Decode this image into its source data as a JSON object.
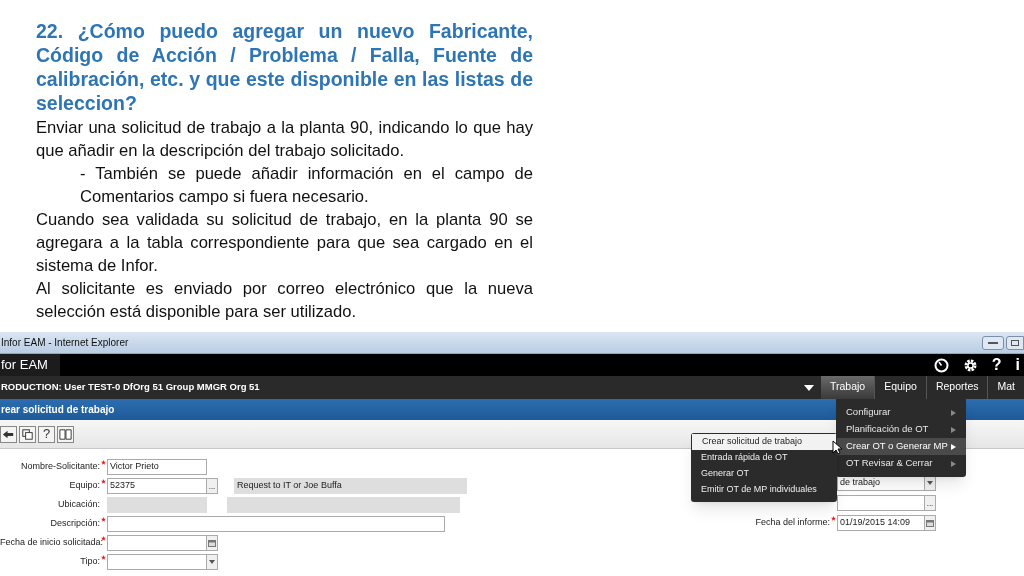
{
  "slide": {
    "title": "22. ¿Cómo puedo agregar un nuevo Fabricante, Código de Acción / Problema / Falla, Fuente de calibración, etc. y que este disponible en las listas de seleccion?",
    "paragraphs": [
      {
        "kind": "body",
        "text": "Enviar una solicitud de trabajo a la planta 90,  indicando  lo que hay que añadir en la descripción del trabajo solicitado."
      },
      {
        "kind": "indented",
        "text": "- También se puede añadir información en el campo de Comentarios campo si fuera necesario."
      },
      {
        "kind": "body",
        "text": "Cuando sea validada su solicitud de trabajo, en la planta 90 se agregara a la tabla correspondiente para que sea cargado en el sistema de Infor."
      },
      {
        "kind": "body",
        "text": "Al solicitante es enviado por correo electrónico que la nueva selección está disponible para ser utilizado."
      }
    ]
  },
  "window": {
    "title": "Infor EAM - Internet Explorer"
  },
  "app": {
    "name": "for EAM",
    "context": "RODUCTION: User TEST-0 DfOrg 51 Group MMGR Org 51",
    "header_icons": [
      {
        "kind": "dashboard"
      },
      {
        "kind": "settings"
      },
      {
        "kind": "help",
        "text": "?"
      },
      {
        "kind": "info",
        "text": "i"
      }
    ],
    "nav": [
      {
        "label": "Trabajo",
        "selected": true
      },
      {
        "label": "Equipo",
        "selected": false
      },
      {
        "label": "Reportes",
        "selected": false
      },
      {
        "label": "Mat",
        "selected": false
      }
    ]
  },
  "page_title": "rear solicitud de trabajo",
  "toolbar": [
    {
      "kind": "back"
    },
    {
      "kind": "copy"
    },
    {
      "kind": "help",
      "text": "?"
    },
    {
      "kind": "book"
    }
  ],
  "form_left": [
    {
      "label": "Nombre-Solicitante:",
      "required": true,
      "kind": "text",
      "value": "Victor Prieto"
    },
    {
      "label": "Equipo:",
      "required": true,
      "kind": "lookup",
      "value": "52375",
      "button": "...",
      "description": "Request to IT or Joe Buffa"
    },
    {
      "label": "Ubicación:",
      "required": false,
      "kind": "readonly"
    },
    {
      "label": "Descripción:",
      "required": true,
      "kind": "wide"
    },
    {
      "label": "Fecha de inicio solicitada:",
      "required": true,
      "kind": "date"
    },
    {
      "label": "Tipo:",
      "required": true,
      "kind": "select"
    }
  ],
  "form_right": [
    {
      "kind": "select",
      "value": "de trabajo"
    },
    {
      "kind": "lookup",
      "button": "..."
    },
    {
      "label": "Fecha del informe:",
      "required": true,
      "kind": "date",
      "value": "01/19/2015 14:09"
    }
  ],
  "menu": [
    {
      "label": "Configurar",
      "selected": false
    },
    {
      "label": "Planificación de OT",
      "selected": false
    },
    {
      "label": "Crear OT o Generar MP",
      "selected": true
    },
    {
      "label": "OT Revisar & Cerrar",
      "selected": false
    }
  ],
  "submenu": [
    {
      "label": "Crear solicitud de trabajo",
      "selected": true
    },
    {
      "label": "Entrada rápida de OT",
      "selected": false
    },
    {
      "label": "Generar OT",
      "selected": false
    },
    {
      "label": "Emitir OT de MP individuales",
      "selected": false
    }
  ]
}
